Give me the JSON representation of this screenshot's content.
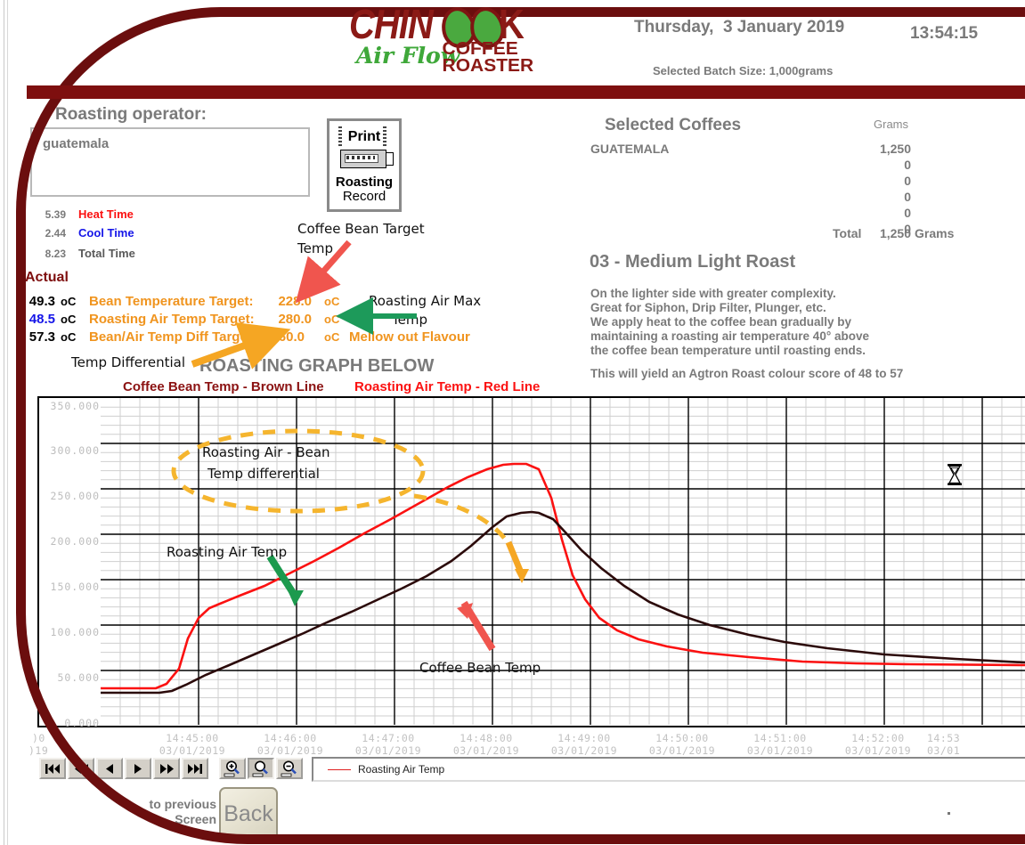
{
  "header": {
    "logo": {
      "chin": "CHIN",
      "k": "K",
      "airflow": "Air Flow",
      "coffee": "COFFEE",
      "roaster": "ROASTER"
    },
    "date": "Thursday,  3 January 2019",
    "time": "13:54:15",
    "batch_size": "Selected Batch Size: 1,000grams"
  },
  "operator": {
    "label": "Roasting operator:",
    "value": "guatemala"
  },
  "print_button": {
    "print": "Print",
    "line1": "Roasting",
    "line2": "Record"
  },
  "times": [
    {
      "value": "5.39",
      "label": "Heat Time",
      "color": "#fb1111"
    },
    {
      "value": "2.44",
      "label": "Cool Time",
      "color": "#1414e8"
    },
    {
      "value": "8.23",
      "label": "Total Time",
      "color": "#5a5a5a"
    }
  ],
  "actual": {
    "title": "Actual",
    "rows": [
      {
        "actual": "49.3",
        "actual_color": "#000000",
        "unit": "oC",
        "label": "Bean Temperature Target:",
        "target": "228.0",
        "target_unit": "oC"
      },
      {
        "actual": "48.5",
        "actual_color": "#1414e8",
        "unit": "oC",
        "label": "Roasting Air Temp Target:",
        "target": "280.0",
        "target_unit": "oC"
      },
      {
        "actual": "57.3",
        "actual_color": "#000000",
        "unit": "oC",
        "label": "Bean/Air Temp Diff Target:",
        "target": "60.0",
        "target_unit": "oC"
      }
    ],
    "mellow": "Mellow out Flavour"
  },
  "annotations": {
    "coffee_bean_target": "Coffee Bean Target\n    Temp",
    "roasting_air_max": "Roasting Air Max",
    "roasting_air_max2": "Temp",
    "temp_differential": "Temp Differential",
    "graph_below": "ROASTING GRAPH BELOW",
    "legend_brown": "Coffee Bean Temp - Brown Line",
    "legend_red": "Roasting Air Temp - Red Line",
    "in_chart_ellipse_l1": "Roasting Air - Bean",
    "in_chart_ellipse_l2": "Temp differential",
    "in_chart_air": "Roasting Air Temp",
    "in_chart_bean": "Coffee Bean Temp"
  },
  "coffees": {
    "title": "Selected Coffees",
    "grams_header": "Grams",
    "name": "GUATEMALA",
    "values": [
      "1,250",
      "0",
      "0",
      "0",
      "0",
      "0"
    ],
    "total_label": "Total",
    "total_value": "1,250",
    "total_unit": "Grams"
  },
  "roast": {
    "title": "03 - Medium Light Roast",
    "description": "On the lighter side with greater complexity.\nGreat for Siphon, Drip Filter, Plunger, etc.\nWe apply heat to the coffee bean gradually by\nmaintaining a roasting air temperature 40° above\nthe coffee bean temperature until roasting ends.",
    "agtron": "This will yield an Agtron Roast colour score of 48 to 57"
  },
  "toolbar": {
    "buttons": [
      {
        "name": "first",
        "glyph": "⏮"
      },
      {
        "name": "rewind",
        "glyph": "◀◀"
      },
      {
        "name": "prev",
        "glyph": "◀"
      },
      {
        "name": "next",
        "glyph": "▶"
      },
      {
        "name": "forward",
        "glyph": "▶▶"
      },
      {
        "name": "last",
        "glyph": "⏭"
      }
    ],
    "zoom_in": "zoom-in-icon",
    "zoom_select": "zoom-select-icon",
    "zoom_out": "zoom-out-icon",
    "zoom_vertical": "zoom-vertical-icon",
    "legend_label": "Roasting Air Temp"
  },
  "back": {
    "caption": "to previous\nScreen",
    "label": "Back"
  },
  "chart_data": {
    "type": "line",
    "title": "ROASTING GRAPH BELOW",
    "xlabel": "",
    "ylabel": "",
    "ylim": [
      0,
      350
    ],
    "yticks": [
      "0.000",
      "50.000",
      "100.000",
      "150.000",
      "200.000",
      "250.000",
      "300.000",
      "350.000"
    ],
    "grid": true,
    "legend_position": "bottom",
    "xticks": [
      {
        "time": "14:45:00",
        "date": "03/01/2019"
      },
      {
        "time": "14:46:00",
        "date": "03/01/2019"
      },
      {
        "time": "14:47:00",
        "date": "03/01/2019"
      },
      {
        "time": "14:48:00",
        "date": "03/01/2019"
      },
      {
        "time": "14:49:00",
        "date": "03/01/2019"
      },
      {
        "time": "14:50:00",
        "date": "03/01/2019"
      },
      {
        "time": "14:51:00",
        "date": "03/01/2019"
      },
      {
        "time": "14:52:00",
        "date": "03/01/2019"
      },
      {
        "time": "14:53",
        "date": "03/01"
      }
    ],
    "series": [
      {
        "name": "Roasting Air Temp",
        "color": "#fb1111",
        "points": [
          [
            0.0,
            40
          ],
          [
            0.08,
            40
          ],
          [
            0.12,
            40
          ],
          [
            0.16,
            42
          ],
          [
            0.2,
            62
          ],
          [
            0.24,
            95
          ],
          [
            0.27,
            118
          ],
          [
            0.3,
            128
          ],
          [
            0.33,
            133
          ],
          [
            0.38,
            141
          ],
          [
            0.44,
            152
          ],
          [
            0.5,
            166
          ],
          [
            0.56,
            180
          ],
          [
            0.62,
            195
          ],
          [
            0.68,
            211
          ],
          [
            0.74,
            227
          ],
          [
            0.8,
            244
          ],
          [
            0.86,
            261
          ],
          [
            0.9,
            272
          ],
          [
            0.94,
            281
          ],
          [
            0.965,
            285
          ],
          [
            0.975,
            286
          ],
          [
            0.985,
            286
          ],
          [
            1.0,
            283
          ],
          [
            1.02,
            250
          ],
          [
            1.04,
            205
          ],
          [
            1.06,
            168
          ],
          [
            1.09,
            140
          ],
          [
            1.13,
            118
          ],
          [
            1.18,
            103
          ],
          [
            1.24,
            92
          ],
          [
            1.32,
            84
          ],
          [
            1.42,
            77
          ],
          [
            1.55,
            72
          ],
          [
            1.7,
            68
          ],
          [
            1.85,
            66
          ],
          [
            2.0,
            65
          ]
        ]
      },
      {
        "name": "Coffee Bean Temp",
        "color": "#2b0a0a",
        "points": [
          [
            0.0,
            35
          ],
          [
            0.1,
            35
          ],
          [
            0.14,
            35
          ],
          [
            0.18,
            37
          ],
          [
            0.22,
            44
          ],
          [
            0.27,
            54
          ],
          [
            0.32,
            64
          ],
          [
            0.38,
            76
          ],
          [
            0.44,
            88
          ],
          [
            0.5,
            100
          ],
          [
            0.56,
            112
          ],
          [
            0.62,
            124
          ],
          [
            0.68,
            137
          ],
          [
            0.74,
            150
          ],
          [
            0.8,
            164
          ],
          [
            0.86,
            180
          ],
          [
            0.9,
            196
          ],
          [
            0.94,
            216
          ],
          [
            0.965,
            228
          ],
          [
            0.98,
            232
          ],
          [
            0.99,
            233
          ],
          [
            1.0,
            232
          ],
          [
            1.03,
            224
          ],
          [
            1.06,
            210
          ],
          [
            1.1,
            192
          ],
          [
            1.15,
            173
          ],
          [
            1.21,
            155
          ],
          [
            1.28,
            138
          ],
          [
            1.36,
            124
          ],
          [
            1.45,
            112
          ],
          [
            1.56,
            101
          ],
          [
            1.68,
            92
          ],
          [
            1.82,
            85
          ],
          [
            2.0,
            78
          ]
        ]
      }
    ],
    "annotations": [
      {
        "text": "Roasting Air - Bean Temp differential",
        "type": "dashed-ellipse-callout"
      },
      {
        "text": "Roasting Air Temp",
        "type": "green-arrow"
      },
      {
        "text": "Coffee Bean Temp",
        "type": "red-arrow"
      }
    ]
  },
  "colors": {
    "brand_dark_red": "#7e0f0f",
    "orange": "#f0941e",
    "air_red": "#fb1111",
    "bean_brown": "#2b0a0a",
    "grey_text": "#7a7a7a"
  }
}
